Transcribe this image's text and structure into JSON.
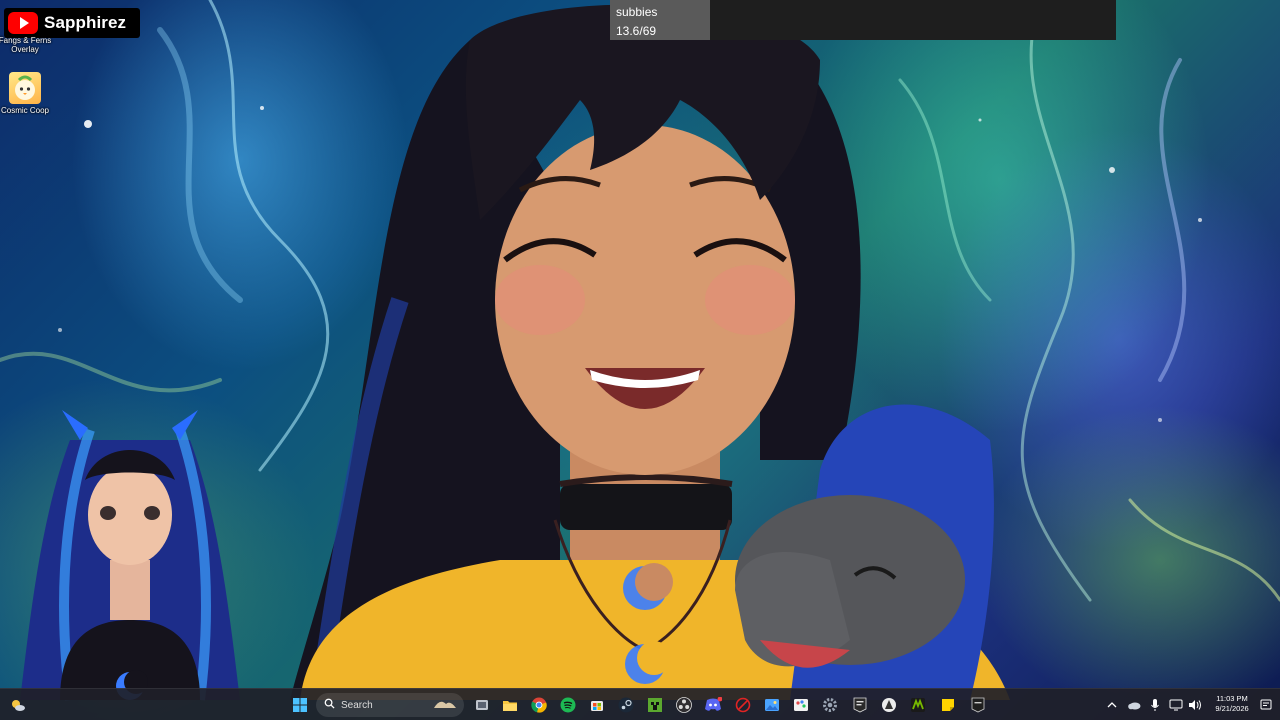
{
  "youtube_badge": {
    "channel_name": "Sapphirez",
    "logo_icon": "youtube-logo-icon",
    "logo_color": "#ff0000"
  },
  "desktop_icons": [
    {
      "label": "Fangs & Ferns Overlay",
      "icon": "fangs-ferns-overlay-icon"
    },
    {
      "label": "Cosmic Coop",
      "icon": "cosmic-coop-icon"
    }
  ],
  "goal": {
    "title": "subbies",
    "progress_text": "13.6/69",
    "current": 13.6,
    "target": 69
  },
  "taskbar": {
    "search_placeholder": "Search",
    "pinned_apps": [
      "windows-start-icon",
      "search-icon",
      "task-view-icon",
      "file-explorer-icon",
      "chrome-icon",
      "spotify-icon",
      "microsoft-store-icon",
      "steam-icon",
      "minecraft-icon",
      "obs-icon",
      "discord-icon",
      "recording-icon",
      "photos-icon",
      "paint-icon",
      "settings-icon",
      "epic-games-icon",
      "app-icon",
      "nvidia-icon",
      "sticky-notes-icon",
      "epic-games-launcher-icon"
    ],
    "tray": {
      "time": "11:03 PM",
      "date": "9/21/2026"
    }
  },
  "colors": {
    "taskbar_bg": "#202028",
    "goal_bg": "#1e1e1e",
    "goal_fill": "#5a5a5a",
    "spotify": "#1db954",
    "discord": "#5865f2",
    "steam": "#1b2838",
    "sticky_notes": "#ffd400"
  }
}
